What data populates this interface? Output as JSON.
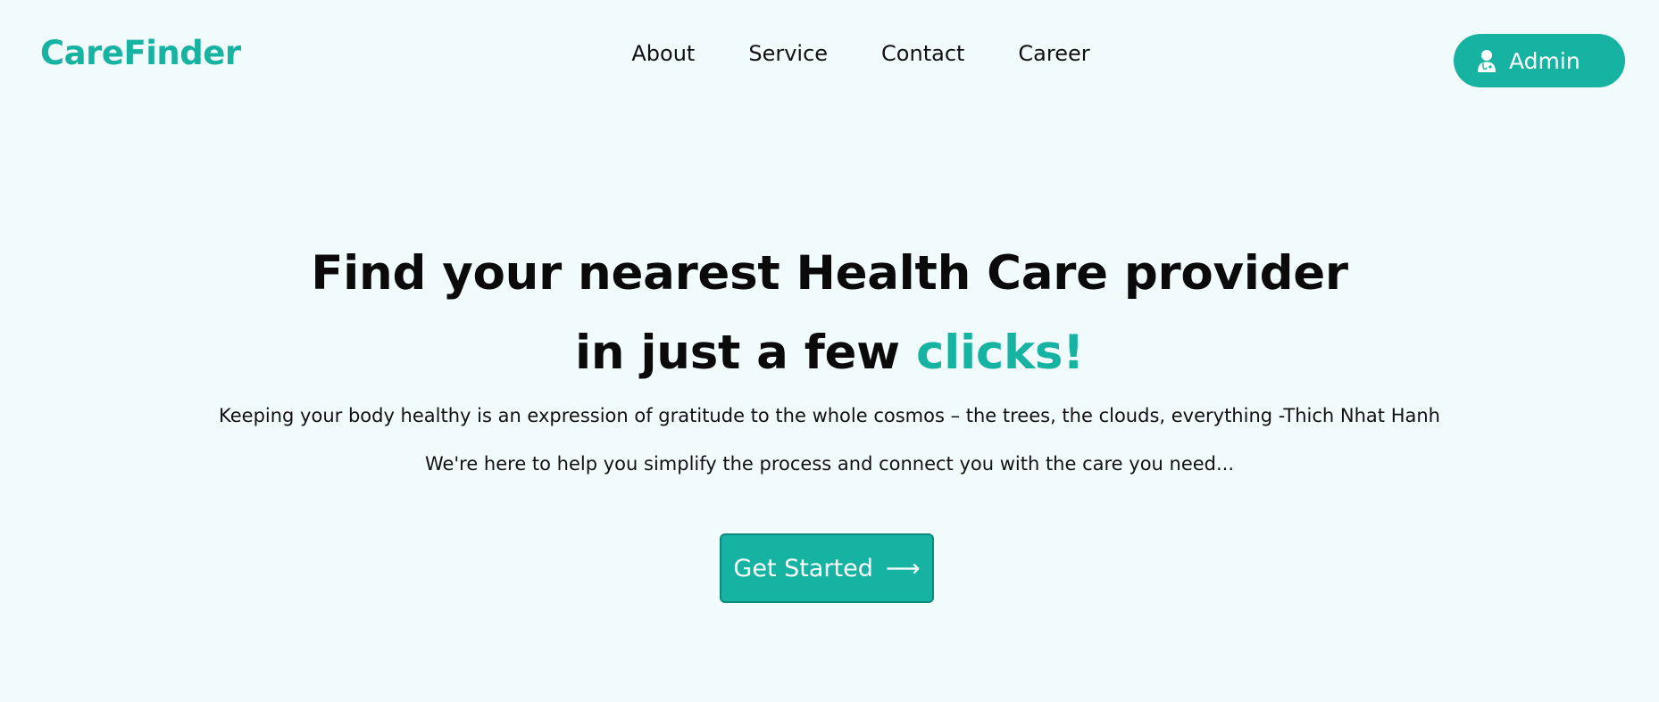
{
  "brand": {
    "name": "CareFinder"
  },
  "nav": {
    "links": [
      {
        "label": "About"
      },
      {
        "label": "Service"
      },
      {
        "label": "Contact"
      },
      {
        "label": "Career"
      }
    ],
    "admin": {
      "label": "Admin",
      "icon": "doctor-user-icon"
    }
  },
  "hero": {
    "title_line1": "Find your nearest Health Care provider",
    "title_line2_prefix": "in just a few ",
    "title_line2_accent": "clicks!",
    "quote": "Keeping your body healthy is an expression of gratitude to the whole cosmos – the trees, the clouds, everything -Thich Nhat Hanh",
    "tagline": "We're here to help you simplify the process and connect you with the care you need...",
    "cta": {
      "label": "Get Started",
      "icon": "arrow-right-icon",
      "glyph": "⟶"
    }
  },
  "colors": {
    "accent": "#17b3a2",
    "background": "#f2fbfb",
    "text": "#111111"
  }
}
